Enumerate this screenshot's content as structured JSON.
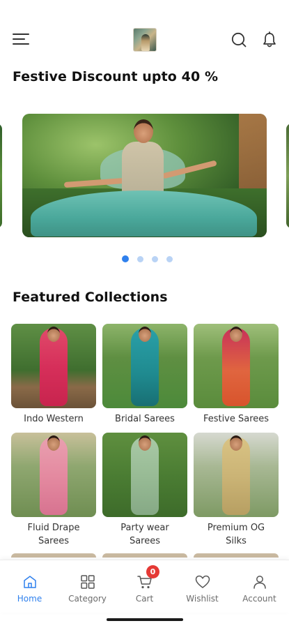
{
  "header": {
    "menu_icon": "hamburger-menu-icon",
    "logo_icon": "brand-logo",
    "search_icon": "search-icon",
    "notification_icon": "bell-icon"
  },
  "promo": {
    "title": "Festive Discount upto 40 %",
    "carousel": {
      "slide_count": 4,
      "active_index": 0
    }
  },
  "featured": {
    "title": "Featured Collections",
    "items": [
      {
        "label": "Indo Western"
      },
      {
        "label": "Bridal Sarees"
      },
      {
        "label": "Festive Sarees"
      },
      {
        "label": "Fluid Drape\nSarees"
      },
      {
        "label": "Party wear\nSarees"
      },
      {
        "label": "Premium OG\nSilks"
      }
    ]
  },
  "bottom_nav": {
    "items": [
      {
        "label": "Home",
        "icon": "home-icon",
        "active": true
      },
      {
        "label": "Category",
        "icon": "category-grid-icon",
        "active": false
      },
      {
        "label": "Cart",
        "icon": "cart-icon",
        "active": false
      },
      {
        "label": "Wishlist",
        "icon": "heart-icon",
        "active": false
      },
      {
        "label": "Account",
        "icon": "user-icon",
        "active": false
      }
    ],
    "cart_badge": "0"
  },
  "colors": {
    "accent": "#2f80ed",
    "badge": "#e53935",
    "text": "#1a1a1a"
  }
}
